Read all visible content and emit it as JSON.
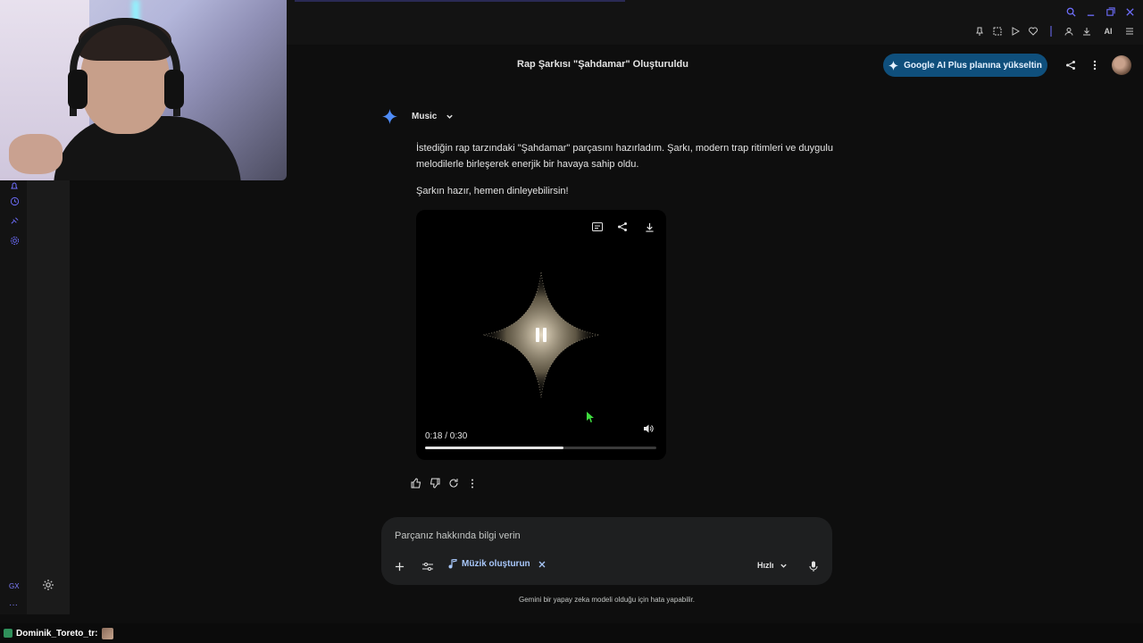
{
  "header": {
    "title": "Rap Şarkısı \"Şahdamar\" Oluşturuldu",
    "upgrade_label": "Google AI Plus planına yükseltin"
  },
  "browser": {
    "ai_label": "AI"
  },
  "response": {
    "model_label": "Music",
    "paragraph_1": "İstediğin rap tarzındaki \"Şahdamar\" parçasını hazırladım. Şarkı, modern trap ritimleri ve duygulu melodilerle birleşerek enerjik bir havaya sahip oldu.",
    "paragraph_2": "Şarkın hazır, hemen dinleyebilirsin!"
  },
  "player": {
    "time": "0:18 / 0:30",
    "progress": 0.6
  },
  "composer": {
    "placeholder": "Parçanız hakkında bilgi verin",
    "chip_label": "Müzik oluşturun",
    "speed_label": "Hızlı"
  },
  "disclaimer": "Gemini bir yapay zeka modeli olduğu için hata yapabilir.",
  "rail": {
    "gx_label": "GX",
    "more_label": "···"
  },
  "stream": {
    "username": "Dominik_Toreto_tr:"
  },
  "colors": {
    "accent": "#a8c7fa",
    "upgrade_bg": "#0f4f7c",
    "background": "#0e0e0e"
  }
}
